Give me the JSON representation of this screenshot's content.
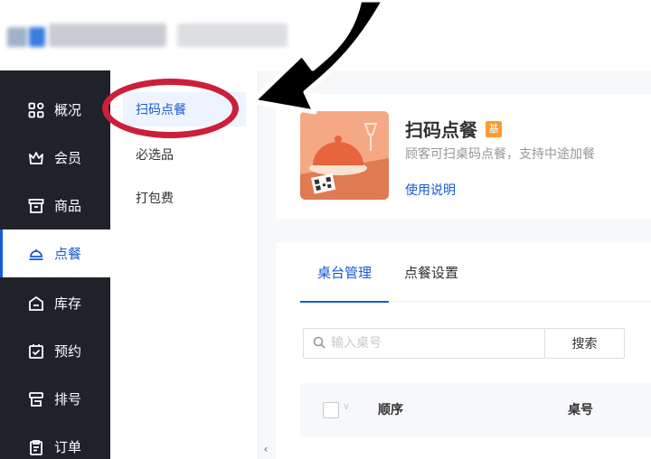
{
  "sidebar": {
    "items": [
      {
        "label": "概况",
        "icon": "grid-icon"
      },
      {
        "label": "会员",
        "icon": "crown-icon"
      },
      {
        "label": "商品",
        "icon": "store-icon"
      },
      {
        "label": "点餐",
        "icon": "dish-cover-icon",
        "active": true
      },
      {
        "label": "库存",
        "icon": "warehouse-icon"
      },
      {
        "label": "预约",
        "icon": "calendar-check-icon"
      },
      {
        "label": "排号",
        "icon": "queue-icon"
      },
      {
        "label": "订单",
        "icon": "order-icon"
      }
    ]
  },
  "submenu": {
    "items": [
      {
        "label": "扫码点餐",
        "active": true
      },
      {
        "label": "必选品"
      },
      {
        "label": "打包费"
      }
    ],
    "collapse_icon": "‹"
  },
  "app_card": {
    "title": "扫码点餐",
    "badge": "基",
    "description": "顾客可扫桌码点餐，支持中途加餐",
    "help_link": "使用说明"
  },
  "tabs": [
    {
      "label": "桌台管理",
      "active": true
    },
    {
      "label": "点餐设置"
    }
  ],
  "search": {
    "placeholder": "输入桌号",
    "button_label": "搜索"
  },
  "table": {
    "headers": [
      "顺序",
      "桌号"
    ]
  },
  "colors": {
    "accent": "#155bd4",
    "sidebar_bg": "#1f2229",
    "annotation": "#cc1f3a",
    "badge": "#ff9a2e"
  }
}
